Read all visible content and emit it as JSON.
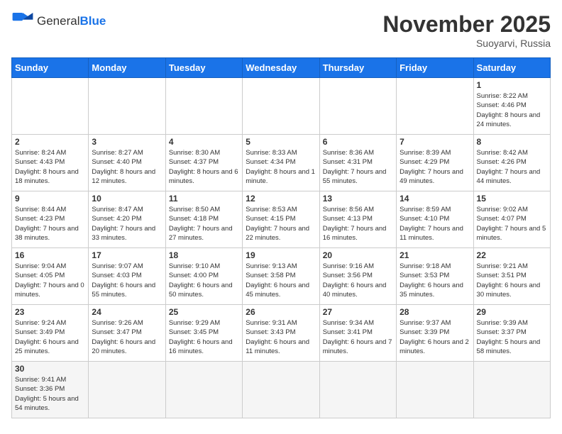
{
  "header": {
    "logo_general": "General",
    "logo_blue": "Blue",
    "month_title": "November 2025",
    "location": "Suoyarvi, Russia"
  },
  "weekdays": [
    "Sunday",
    "Monday",
    "Tuesday",
    "Wednesday",
    "Thursday",
    "Friday",
    "Saturday"
  ],
  "weeks": [
    [
      {
        "day": "",
        "info": ""
      },
      {
        "day": "",
        "info": ""
      },
      {
        "day": "",
        "info": ""
      },
      {
        "day": "",
        "info": ""
      },
      {
        "day": "",
        "info": ""
      },
      {
        "day": "",
        "info": ""
      },
      {
        "day": "1",
        "info": "Sunrise: 8:22 AM\nSunset: 4:46 PM\nDaylight: 8 hours and 24 minutes."
      }
    ],
    [
      {
        "day": "2",
        "info": "Sunrise: 8:24 AM\nSunset: 4:43 PM\nDaylight: 8 hours and 18 minutes."
      },
      {
        "day": "3",
        "info": "Sunrise: 8:27 AM\nSunset: 4:40 PM\nDaylight: 8 hours and 12 minutes."
      },
      {
        "day": "4",
        "info": "Sunrise: 8:30 AM\nSunset: 4:37 PM\nDaylight: 8 hours and 6 minutes."
      },
      {
        "day": "5",
        "info": "Sunrise: 8:33 AM\nSunset: 4:34 PM\nDaylight: 8 hours and 1 minute."
      },
      {
        "day": "6",
        "info": "Sunrise: 8:36 AM\nSunset: 4:31 PM\nDaylight: 7 hours and 55 minutes."
      },
      {
        "day": "7",
        "info": "Sunrise: 8:39 AM\nSunset: 4:29 PM\nDaylight: 7 hours and 49 minutes."
      },
      {
        "day": "8",
        "info": "Sunrise: 8:42 AM\nSunset: 4:26 PM\nDaylight: 7 hours and 44 minutes."
      }
    ],
    [
      {
        "day": "9",
        "info": "Sunrise: 8:44 AM\nSunset: 4:23 PM\nDaylight: 7 hours and 38 minutes."
      },
      {
        "day": "10",
        "info": "Sunrise: 8:47 AM\nSunset: 4:20 PM\nDaylight: 7 hours and 33 minutes."
      },
      {
        "day": "11",
        "info": "Sunrise: 8:50 AM\nSunset: 4:18 PM\nDaylight: 7 hours and 27 minutes."
      },
      {
        "day": "12",
        "info": "Sunrise: 8:53 AM\nSunset: 4:15 PM\nDaylight: 7 hours and 22 minutes."
      },
      {
        "day": "13",
        "info": "Sunrise: 8:56 AM\nSunset: 4:13 PM\nDaylight: 7 hours and 16 minutes."
      },
      {
        "day": "14",
        "info": "Sunrise: 8:59 AM\nSunset: 4:10 PM\nDaylight: 7 hours and 11 minutes."
      },
      {
        "day": "15",
        "info": "Sunrise: 9:02 AM\nSunset: 4:07 PM\nDaylight: 7 hours and 5 minutes."
      }
    ],
    [
      {
        "day": "16",
        "info": "Sunrise: 9:04 AM\nSunset: 4:05 PM\nDaylight: 7 hours and 0 minutes."
      },
      {
        "day": "17",
        "info": "Sunrise: 9:07 AM\nSunset: 4:03 PM\nDaylight: 6 hours and 55 minutes."
      },
      {
        "day": "18",
        "info": "Sunrise: 9:10 AM\nSunset: 4:00 PM\nDaylight: 6 hours and 50 minutes."
      },
      {
        "day": "19",
        "info": "Sunrise: 9:13 AM\nSunset: 3:58 PM\nDaylight: 6 hours and 45 minutes."
      },
      {
        "day": "20",
        "info": "Sunrise: 9:16 AM\nSunset: 3:56 PM\nDaylight: 6 hours and 40 minutes."
      },
      {
        "day": "21",
        "info": "Sunrise: 9:18 AM\nSunset: 3:53 PM\nDaylight: 6 hours and 35 minutes."
      },
      {
        "day": "22",
        "info": "Sunrise: 9:21 AM\nSunset: 3:51 PM\nDaylight: 6 hours and 30 minutes."
      }
    ],
    [
      {
        "day": "23",
        "info": "Sunrise: 9:24 AM\nSunset: 3:49 PM\nDaylight: 6 hours and 25 minutes."
      },
      {
        "day": "24",
        "info": "Sunrise: 9:26 AM\nSunset: 3:47 PM\nDaylight: 6 hours and 20 minutes."
      },
      {
        "day": "25",
        "info": "Sunrise: 9:29 AM\nSunset: 3:45 PM\nDaylight: 6 hours and 16 minutes."
      },
      {
        "day": "26",
        "info": "Sunrise: 9:31 AM\nSunset: 3:43 PM\nDaylight: 6 hours and 11 minutes."
      },
      {
        "day": "27",
        "info": "Sunrise: 9:34 AM\nSunset: 3:41 PM\nDaylight: 6 hours and 7 minutes."
      },
      {
        "day": "28",
        "info": "Sunrise: 9:37 AM\nSunset: 3:39 PM\nDaylight: 6 hours and 2 minutes."
      },
      {
        "day": "29",
        "info": "Sunrise: 9:39 AM\nSunset: 3:37 PM\nDaylight: 5 hours and 58 minutes."
      }
    ],
    [
      {
        "day": "30",
        "info": "Sunrise: 9:41 AM\nSunset: 3:36 PM\nDaylight: 5 hours and 54 minutes."
      },
      {
        "day": "",
        "info": ""
      },
      {
        "day": "",
        "info": ""
      },
      {
        "day": "",
        "info": ""
      },
      {
        "day": "",
        "info": ""
      },
      {
        "day": "",
        "info": ""
      },
      {
        "day": "",
        "info": ""
      }
    ]
  ]
}
